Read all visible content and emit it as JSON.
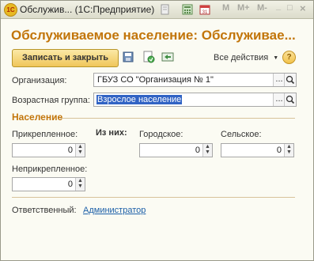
{
  "window": {
    "title": "Обслужив... (1С:Предприятие)",
    "logo": "1С",
    "toolbar": {
      "m": "M",
      "m_plus": "M+",
      "m_minus": "M-",
      "minimize": "_",
      "maximize": "□",
      "close": "×"
    }
  },
  "form": {
    "title": "Обслуживаемое население: Обслуживае...",
    "write_close": "Записать и закрыть",
    "all_actions": "Все действия",
    "help": "?"
  },
  "fields": {
    "org_label": "Организация:",
    "org_value": "ГБУЗ СО \"Организация № 1\"",
    "age_label": "Возрастная группа:",
    "age_value": "Взрослое население",
    "dots": "..."
  },
  "population": {
    "section": "Население",
    "attached_label": "Прикрепленное:",
    "of_them": "Из них:",
    "urban_label": "Городское:",
    "rural_label": "Сельское:",
    "unattached_label": "Неприкрепленное:",
    "attached_value": "0",
    "urban_value": "0",
    "rural_value": "0",
    "unattached_value": "0",
    "spin_up": "▲",
    "spin_down": "▼"
  },
  "footer": {
    "responsible_label": "Ответственный:",
    "responsible_value": "Администратор"
  }
}
